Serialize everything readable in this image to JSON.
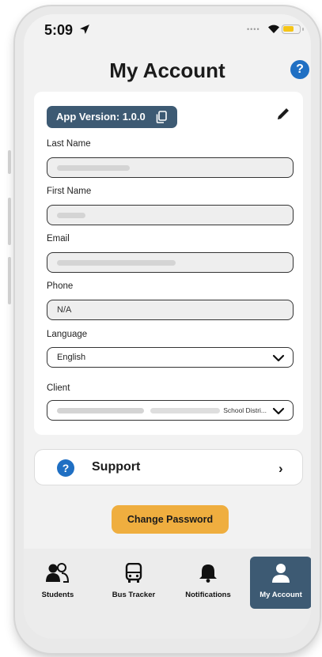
{
  "status_bar": {
    "time": "5:09"
  },
  "header": {
    "title": "My Account",
    "help_label": "?"
  },
  "account": {
    "version_label": "App Version: 1.0.0",
    "fields": [
      {
        "label": "Last Name",
        "value": ""
      },
      {
        "label": "First Name",
        "value": ""
      },
      {
        "label": "Email",
        "value": ""
      },
      {
        "label": "Phone",
        "value": "N/A"
      }
    ],
    "language": {
      "label": "Language",
      "selected": "English"
    },
    "client": {
      "label": "Client",
      "selected_suffix": "School Distri..."
    }
  },
  "support": {
    "icon_label": "?",
    "label": "Support",
    "chevron": "›"
  },
  "change_password_label": "Change Password",
  "tabs": [
    {
      "label": "Students",
      "icon": "students-icon"
    },
    {
      "label": "Bus Tracker",
      "icon": "bus-icon"
    },
    {
      "label": "Notifications",
      "icon": "bell-icon"
    },
    {
      "label": "My Account",
      "icon": "person-icon",
      "active": true
    }
  ],
  "colors": {
    "primary": "#3d5a73",
    "accent": "#efae3f",
    "help_blue": "#1f6fc3",
    "battery": "#f5c518"
  }
}
